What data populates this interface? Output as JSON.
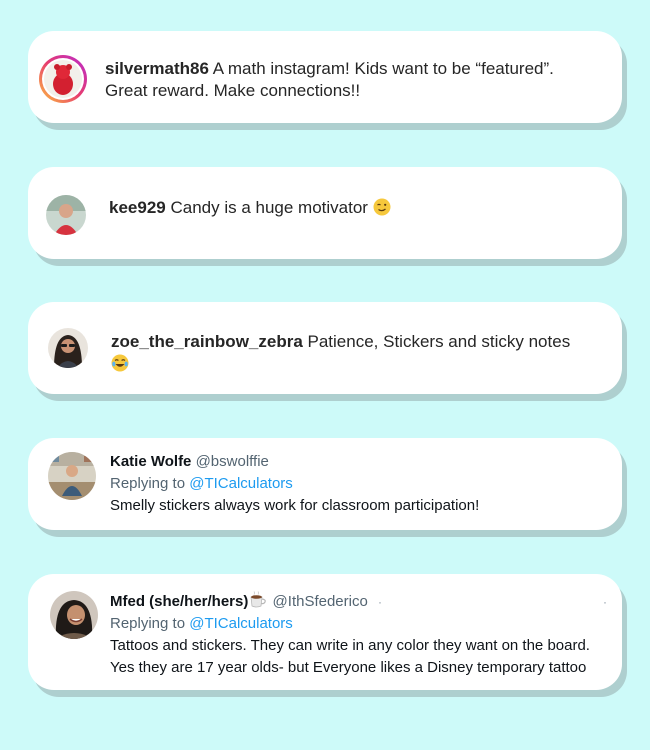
{
  "comments": [
    {
      "platform": "instagram",
      "username": "silvermath86",
      "text_line1": "A math instagram! Kids want to be “featured”.",
      "text_line2": "Great reward. Make connections!!"
    },
    {
      "platform": "instagram",
      "username": "kee929",
      "text": "Candy is a huge motivator"
    },
    {
      "platform": "instagram",
      "username": "zoe_the_rainbow_zebra",
      "text": "Patience, Stickers and sticky notes"
    },
    {
      "platform": "twitter",
      "display_name": "Katie Wolfe",
      "handle": "@bswolffie",
      "replying_prefix": "Replying to",
      "replying_to": "@TICalculators",
      "text": "Smelly stickers always work for classroom participation!"
    },
    {
      "platform": "twitter",
      "display_name": "Mfed (she/her/hers)",
      "handle": "@IthSfederico",
      "replying_prefix": "Replying to",
      "replying_to": "@TICalculators",
      "text_line1": "Tattoos and stickers.  They can write in any color they want on the board.",
      "text_line2": "Yes they are 17 year olds- but Everyone likes a Disney temporary tattoo"
    }
  ],
  "colors": {
    "background": "#cdfaf9",
    "card": "#ffffff",
    "shadow": "#aecfcf",
    "mention_blue": "#1d9bf0",
    "handle_gray": "#536471"
  }
}
